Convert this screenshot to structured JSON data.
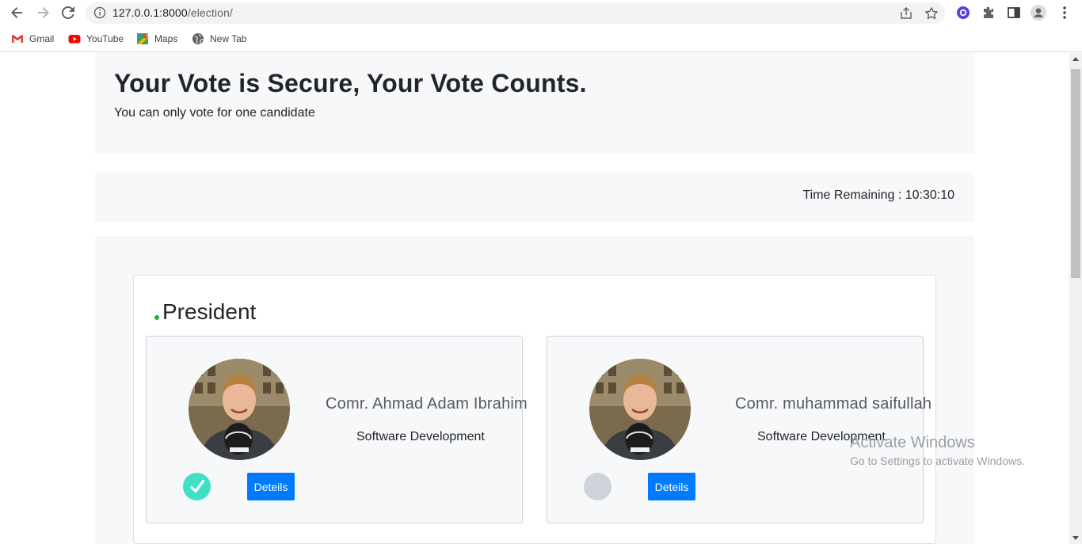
{
  "browser": {
    "url_host": "127.0.0.1:8000",
    "url_path": "/election/",
    "bookmarks": [
      {
        "label": "Gmail",
        "icon": "gmail-icon"
      },
      {
        "label": "YouTube",
        "icon": "youtube-icon"
      },
      {
        "label": "Maps",
        "icon": "maps-icon"
      },
      {
        "label": "New Tab",
        "icon": "globe-icon"
      }
    ]
  },
  "page": {
    "heading": "Your Vote is Secure, Your Vote Counts.",
    "subheading": "You can only vote for one candidate",
    "timer_label": "Time Remaining : 10:30:10",
    "position_title": "President",
    "candidates": [
      {
        "name": "Comr. Ahmad Adam Ibrahim",
        "department": "Software Development",
        "selected": true,
        "details_label": "Deteils"
      },
      {
        "name": "Comr. muhammad saifullah",
        "department": "Software Development",
        "selected": false,
        "details_label": "Deteils"
      }
    ]
  },
  "watermark": {
    "line1": "Activate Windows",
    "line2": "Go to Settings to activate Windows."
  },
  "colors": {
    "accent": "#007bff",
    "selected": "#40e0c8",
    "unselected": "#cfd3da",
    "status_dot": "#28a745"
  }
}
